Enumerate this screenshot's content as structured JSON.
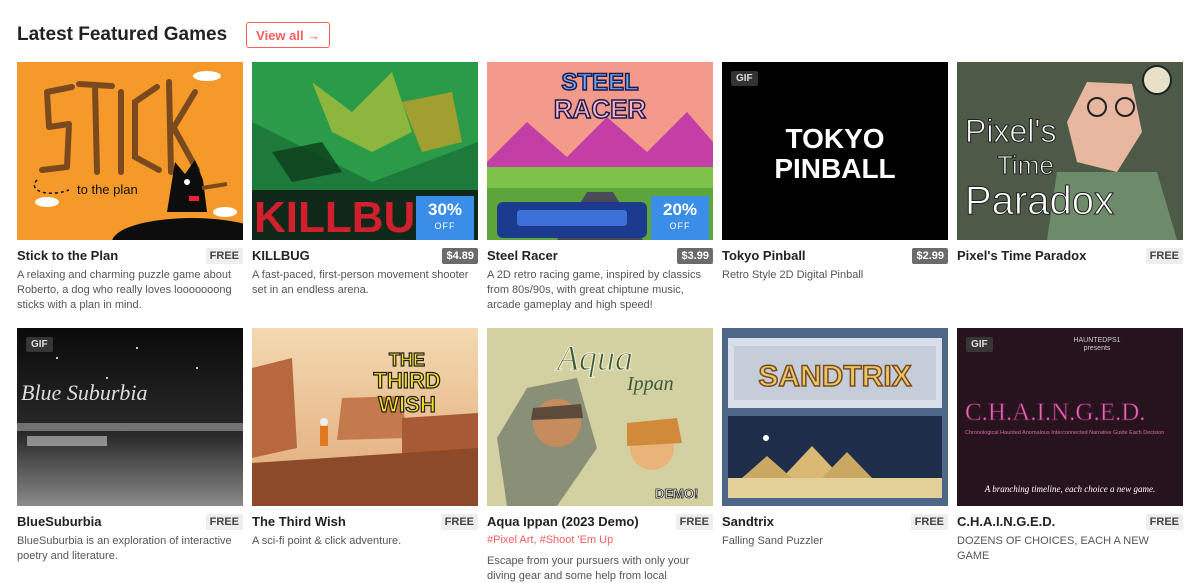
{
  "header": {
    "title": "Latest Featured Games",
    "view_all": "View all →"
  },
  "games": [
    {
      "title": "Stick to the Plan",
      "price": "FREE",
      "desc": "A relaxing and charming puzzle game about Roberto, a dog who really loves looooooong sticks with a plan in mind.",
      "art_text": "STICK",
      "art_sub": "to the plan"
    },
    {
      "title": "KILLBUG",
      "price": "$4.89",
      "desc": "A fast-paced, first-person movement shooter set in an endless arena.",
      "art_text": "KILLBUG",
      "sale_pct": "30%",
      "sale_off": "OFF"
    },
    {
      "title": "Steel Racer",
      "price": "$3.99",
      "desc": "A 2D retro racing game, inspired by classics from 80s/90s, with great chiptune music, arcade gameplay and high speed!",
      "art_text_1": "STEEL",
      "art_text_2": "RACER",
      "sale_pct": "20%",
      "sale_off": "OFF"
    },
    {
      "title": "Tokyo Pinball",
      "price": "$2.99",
      "desc": "Retro Style 2D Digital Pinball",
      "gif": "GIF",
      "art_text_1": "TOKYO",
      "art_text_2": "PINBALL"
    },
    {
      "title": "Pixel's Time Paradox",
      "price": "FREE",
      "desc": "",
      "art_text_1": "Pixel's",
      "art_text_2": "Time",
      "art_text_3": "Paradox"
    },
    {
      "title": "BlueSuburbia",
      "price": "FREE",
      "desc": "BlueSuburbia is an exploration of interactive poetry and literature.",
      "gif": "GIF",
      "art_text": "Blue Suburbia"
    },
    {
      "title": "The Third Wish",
      "price": "FREE",
      "desc": "A sci-fi point & click adventure.",
      "art_text_1": "THE",
      "art_text_2": "THIRD",
      "art_text_3": "WISH"
    },
    {
      "title": "Aqua Ippan (2023 Demo)",
      "price": "FREE",
      "tags": "#Pixel Art, #Shoot 'Em Up",
      "desc": "Escape from your pursuers with only your diving gear and some help from local",
      "art_text_1": "Aqua",
      "art_text_2": "Ippan",
      "art_text_3": "DEMO!"
    },
    {
      "title": "Sandtrix",
      "price": "FREE",
      "desc": "Falling Sand Puzzler",
      "art_text": "SANDTRIX"
    },
    {
      "title": "C.H.A.I.N.G.E.D.",
      "price": "FREE",
      "desc": "DOZENS OF CHOICES, EACH A NEW GAME",
      "gif": "GIF",
      "art_text_1": "HAUNTEDPS1",
      "art_text_2": "presents",
      "art_text_3": "C.H.A.I.N.G.E.D.",
      "art_text_4": "Chronological Haunted Anomalous Interconnected Narrative Guide Each Decision",
      "art_text_5": "A branching timeline, each choice a new game."
    }
  ]
}
